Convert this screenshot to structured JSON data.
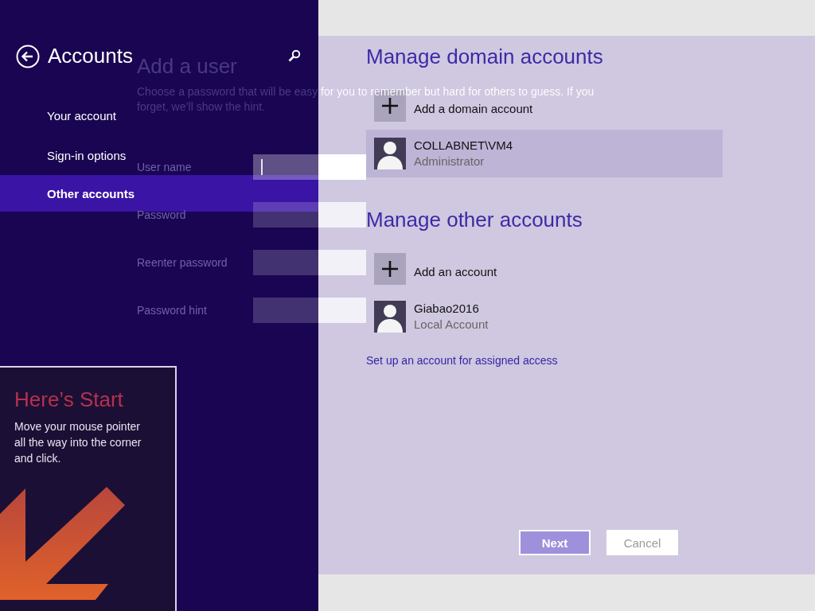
{
  "settings_pane": {
    "title": "Accounts",
    "nav_items": [
      {
        "label": "Your account",
        "selected": false
      },
      {
        "label": "Sign-in options",
        "selected": false
      },
      {
        "label": "Other accounts",
        "selected": true
      }
    ]
  },
  "sections": [
    {
      "heading": "Manage domain accounts",
      "add_label": "Add a domain account",
      "accounts": [
        {
          "name": "COLLABNET\\VM4",
          "type": "Administrator",
          "selected": true
        }
      ]
    },
    {
      "heading": "Manage other accounts",
      "add_label": "Add an account",
      "accounts": [
        {
          "name": "Giabao2016",
          "type": "Local Account",
          "selected": false
        }
      ]
    }
  ],
  "assigned_access_link": "Set up an account for assigned access",
  "add_user_dialog": {
    "title": "Add a user",
    "hint": "Choose a password that will be easy for you to remember but hard for others to guess. If you forget, we’ll show the hint.",
    "fields": [
      {
        "label": "User name",
        "focused": true
      },
      {
        "label": "Password",
        "focused": false
      },
      {
        "label": "Reenter password",
        "focused": false
      },
      {
        "label": "Password hint",
        "focused": false
      }
    ],
    "buttons": [
      {
        "label": "Next",
        "primary": true
      },
      {
        "label": "Cancel",
        "primary": false
      }
    ]
  },
  "start_tip": {
    "title": "Here’s Start",
    "text": "Move your mouse pointer all the way into the corner and click."
  }
}
